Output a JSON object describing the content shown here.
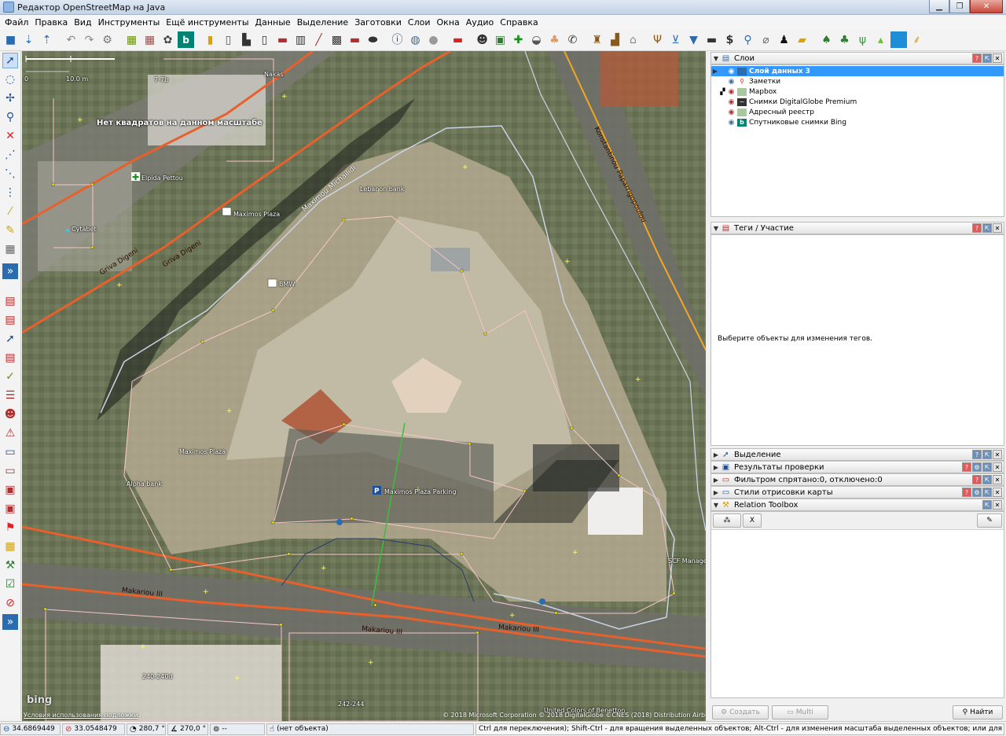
{
  "window": {
    "title": "Редактор OpenStreetMap на Java"
  },
  "menu": [
    "Файл",
    "Правка",
    "Вид",
    "Инструменты",
    "Ещё инструменты",
    "Данные",
    "Выделение",
    "Заготовки",
    "Слои",
    "Окна",
    "Аудио",
    "Справка"
  ],
  "map": {
    "scale_zero": "0",
    "scale_label": "10.0 m",
    "no_tiles_notice": "Нет квадратов на данном масштабе",
    "labels": {
      "house_7": "7-7b",
      "nakas": "Nakas",
      "elpida": "Elpida Pettou",
      "cytabet": "Cytabet",
      "maximos_plaza_bus": "Maximos Plaza",
      "bmw": "BMW",
      "lebanon_bank": "Lebanon bank",
      "maximos_plaza": "Maximos Plaza",
      "alpha_bank": "Alpha bank",
      "parking": "Maximos Plaza Parking",
      "scf": "SCF Manage",
      "house_240": "240-240d",
      "house_242": "242-244",
      "benetton": "United Colors of Benetton"
    },
    "roads": {
      "grivas_1": "Griva Digeni",
      "grivas_2": "Griva Digeni",
      "maximou": "Maximou Michailidi",
      "konst": "Konstantinou Paparrigopoulou",
      "makariou_1": "Makariou III",
      "makariou_2": "Makariou III"
    },
    "bing_logo": "bing",
    "terms": "Условия использования подложки",
    "attribution": "© 2018 Microsoft Corporation © 2018 DigitalGlobe ©CNES (2018) Distribution Airbus DS"
  },
  "layers_panel": {
    "title": "Слои",
    "items": [
      {
        "name": "Слой данных 3",
        "selected": true
      },
      {
        "name": "Заметки",
        "selected": false
      },
      {
        "name": "Mapbox",
        "selected": false
      },
      {
        "name": "Снимки DigitalGlobe Premium",
        "selected": false
      },
      {
        "name": "Адресный реестр",
        "selected": false
      },
      {
        "name": "Спутниковые снимки Bing",
        "selected": false
      }
    ]
  },
  "tags_panel": {
    "title": "Теги / Участие",
    "empty_message": "Выберите объекты для изменения тегов."
  },
  "collapsed_panels": [
    "Выделение",
    "Результаты проверки",
    "Фильтром спрятано:0, отключено:0",
    "Стили отрисовки карты"
  ],
  "relation_toolbox": {
    "title": "Relation Toolbox",
    "remove_label": "X"
  },
  "bottom_buttons": {
    "create": "Создать",
    "multi": "Multi",
    "find": "Найти"
  },
  "status": {
    "lat": "34.6869449",
    "lon": "33.0548479",
    "heading": "280,7 °",
    "angle": "270,0 °",
    "distance": "--",
    "object": "(нет объекта)",
    "help": "Ctrl для переключения); Shift-Ctrl - для вращения выделенных объектов; Alt-Ctrl - для изменения масштаба выделенных объектов; или для изменения выделения"
  },
  "colors": {
    "selection": "#3399ff",
    "road_primary": "#e8602c",
    "road_secondary": "#f5a623",
    "way": "#f5c6c6",
    "node": "#ffff00"
  }
}
